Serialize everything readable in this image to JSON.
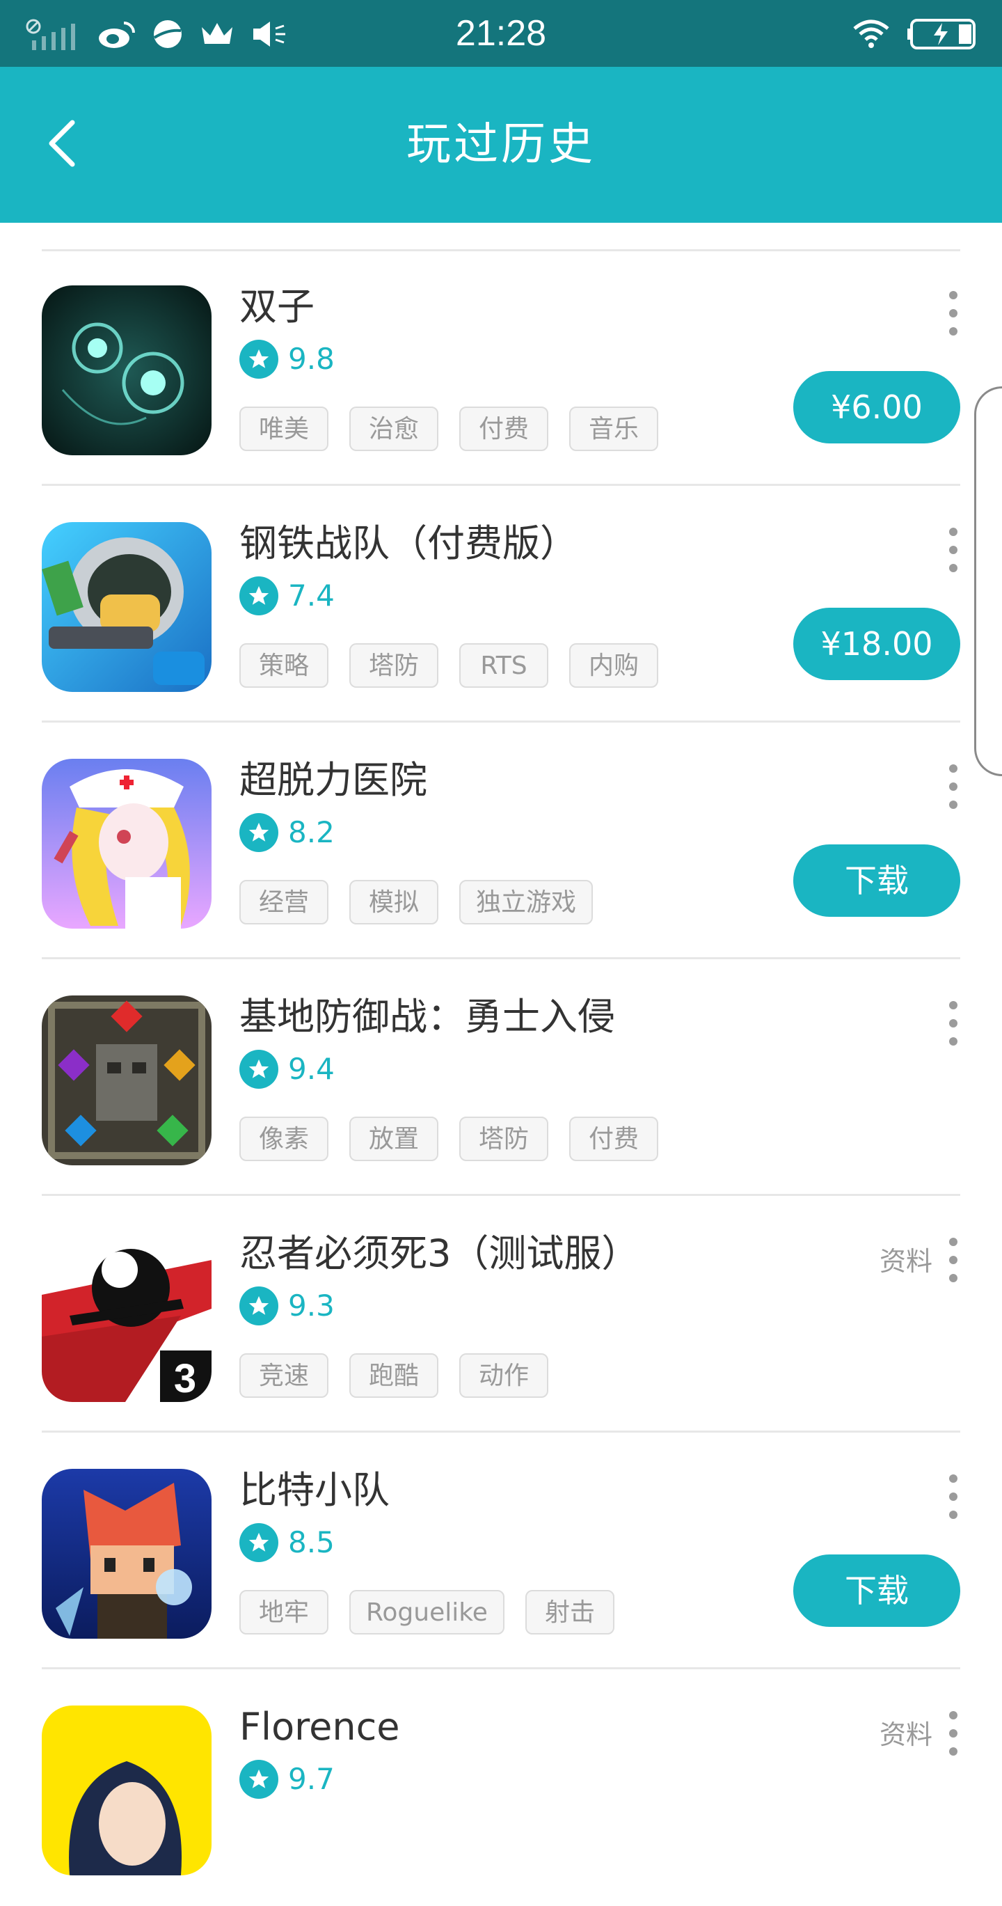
{
  "status_bar": {
    "time": "21:28"
  },
  "header": {
    "title": "玩过历史"
  },
  "games": [
    {
      "name": "双子",
      "rating": "9.8",
      "tags": [
        "唯美",
        "治愈",
        "付费",
        "音乐"
      ],
      "action": "¥6.00",
      "info": ""
    },
    {
      "name": "钢铁战队（付费版）",
      "rating": "7.4",
      "tags": [
        "策略",
        "塔防",
        "RTS",
        "内购"
      ],
      "action": "¥18.00",
      "info": ""
    },
    {
      "name": "超脱力医院",
      "rating": "8.2",
      "tags": [
        "经营",
        "模拟",
        "独立游戏"
      ],
      "action": "下载",
      "info": ""
    },
    {
      "name": "基地防御战：勇士入侵",
      "rating": "9.4",
      "tags": [
        "像素",
        "放置",
        "塔防",
        "付费"
      ],
      "action": "",
      "info": ""
    },
    {
      "name": "忍者必须死3（测试服）",
      "rating": "9.3",
      "tags": [
        "竞速",
        "跑酷",
        "动作"
      ],
      "action": "",
      "info": "资料"
    },
    {
      "name": "比特小队",
      "rating": "8.5",
      "tags": [
        "地牢",
        "Roguelike",
        "射击"
      ],
      "action": "下载",
      "info": ""
    },
    {
      "name": "Florence",
      "rating": "9.7",
      "tags": [],
      "action": "",
      "info": "资料"
    }
  ],
  "colors": {
    "accent": "#1ab5c2",
    "status_bar": "#14757c"
  },
  "icons": [
    "back-arrow-icon",
    "star-icon",
    "more-vertical-icon",
    "wifi-icon",
    "battery-icon",
    "signal-icon",
    "weibo-icon",
    "volume-icon"
  ]
}
